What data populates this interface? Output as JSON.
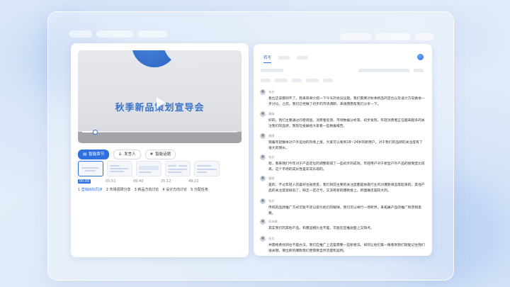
{
  "video": {
    "title": "秋季新品策划宣导会",
    "progress_fraction": 0.08
  },
  "left_tabs": [
    {
      "label": "智能章节",
      "icon": "chapter-icon",
      "active": true
    },
    {
      "label": "发言人",
      "icon": "person-icon",
      "active": false
    },
    {
      "label": "智能话题",
      "icon": "topic-icon",
      "active": false
    }
  ],
  "chapters": [
    {
      "time": "00:00",
      "label": "1 营销目标同步",
      "active": true
    },
    {
      "time": "05:52",
      "label": "2 市场调研分享",
      "active": false
    },
    {
      "time": "09:40",
      "label": "3 新品方向讨论",
      "active": false
    },
    {
      "time": "25:12",
      "label": "4 设计方向讨论",
      "active": false
    },
    {
      "time": "49:22",
      "label": "5 分配任务",
      "active": false
    }
  ],
  "right_panel": {
    "active_tab": "转写"
  },
  "transcript": [
    {
      "speaker": "张总",
      "text": "各位应该都到齐了。我来简单介绍一下今天的会议议题。我们需要对秋季新品的定位以及设计方向做进一步讨论。之前，我们已经做了初步的市场调研，来请唐唐帮我们分享一下。"
    },
    {
      "speaker": "唐唐",
      "text": "好的。我们主要通过问卷调查、消费者反馈、市场数据分析等、初步发现，年轻消费者正在越来越多的关注我们的品牌，我现在投屏给大家看一些数据报告。"
    },
    {
      "speaker": "唐唐",
      "text": "随着年轻群体对户外运动的热情上涨，大家可以看到18~24岁的新用户，对于我们的品牌的关注度有了很大的增长。"
    },
    {
      "speaker": "张总",
      "text": "嗯，看来我们今年对于产品定位的调整取得了一些初步的成效。年轻用户对于新型户外产品的接受度比较高，这个市场的成长性是非常乐观的。"
    },
    {
      "speaker": "唐唐",
      "text": "是的，不过年轻人的喜好也很善变，我们目前主要的关注度都是依靠行业内对爆款单品等起来的，其他产品的关注度就很低了，缺乏一定迁亏。又没有新的爆款接上，新面难还是较大的。"
    },
    {
      "speaker": "张总",
      "text": "传统的品牌推广方式可能不足以吸引他们的眼球，我们可以举行一场跨界，来拓展产品的推广和营销思路。"
    },
    {
      "speaker": "阿米娜",
      "text": "其实我们的其他产品，和爆品相比也不差，可能在宣推层面上又缺点。"
    },
    {
      "speaker": "张总",
      "text": "共需格勇找到也不是办法。我们应推广上还是需要一些新想法。如何让他们第一眼看到我们就能记住我们很关键，要出新的爆款我们更需要自然流量和案例。"
    }
  ]
}
